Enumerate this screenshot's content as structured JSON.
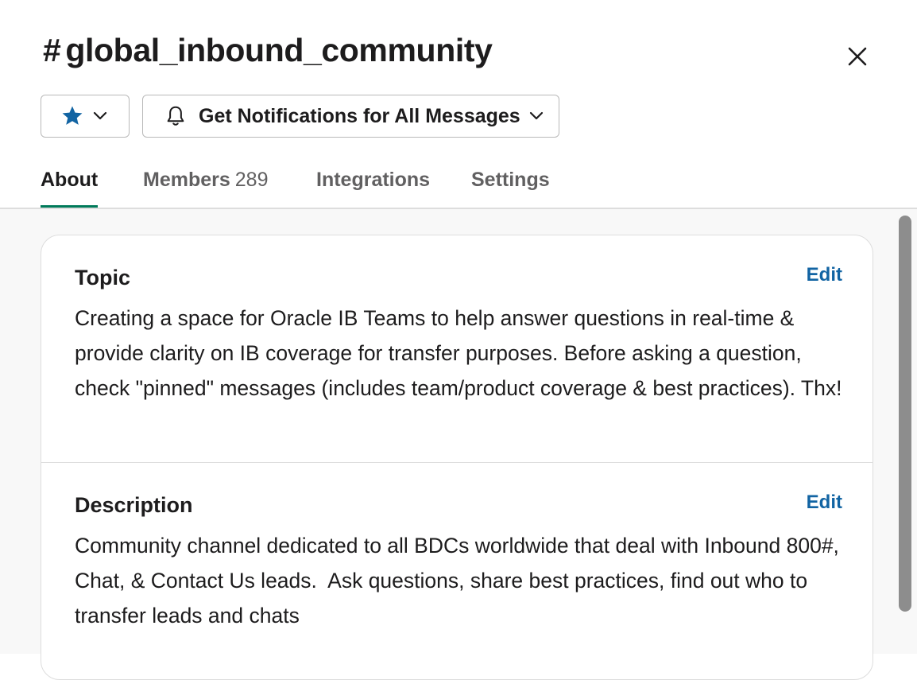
{
  "channel": {
    "hash": "#",
    "name": "global_inbound_community"
  },
  "header": {
    "star_icon": "star-icon",
    "notifications_label": "Get Notifications for All Messages",
    "close_icon": "close-icon"
  },
  "tabs": [
    {
      "label": "About",
      "active": true
    },
    {
      "label": "Members",
      "count": "289"
    },
    {
      "label": "Integrations"
    },
    {
      "label": "Settings"
    }
  ],
  "sections": [
    {
      "title": "Topic",
      "edit_label": "Edit",
      "text": "Creating a space for Oracle IB Teams to help answer questions in real-time & provide clarity on IB coverage for transfer purposes. Before asking a question, check \"pinned\" messages (includes team/product coverage & best practices). Thx!"
    },
    {
      "title": "Description",
      "edit_label": "Edit",
      "text": "Community channel dedicated to all BDCs worldwide that deal with Inbound 800#, Chat, & Contact Us leads.  Ask questions, share best practices, find out who to transfer leads and chats"
    }
  ],
  "colors": {
    "accent_tab": "#007a5a",
    "link": "#1264a3",
    "star": "#1264a3"
  }
}
